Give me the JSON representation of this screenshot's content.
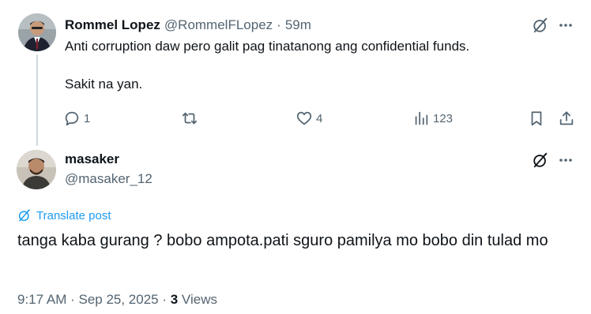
{
  "parent_tweet": {
    "author_name": "Rommel Lopez",
    "author_handle": "@RommelFLopez",
    "separator": "·",
    "time": "59m",
    "text_line_1": "Anti corruption daw pero galit pag tinatanong ang confidential funds.",
    "text_line_2": "Sakit na yan.",
    "actions": {
      "replies": "1",
      "retweets": "",
      "likes": "4",
      "views": "123"
    }
  },
  "main_tweet": {
    "author_name": "masaker",
    "author_handle": "@masaker_12",
    "translate_label": "Translate post",
    "text": "tanga kaba gurang ? bobo ampota.pati sguro pamilya mo bobo din tulad mo",
    "timestamp": "9:17 AM · Sep 25, 2025 · ",
    "views_count": "3",
    "views_label": " Views"
  },
  "colors": {
    "text_primary": "#0f1419",
    "text_secondary": "#536471",
    "accent_blue": "#1d9bf0",
    "thread_line": "#cfd9de"
  },
  "icons": {
    "grok": "grok-icon",
    "more": "more-icon",
    "reply": "reply-icon",
    "retweet": "retweet-icon",
    "like": "heart-icon",
    "views": "views-icon",
    "bookmark": "bookmark-icon",
    "share": "share-icon",
    "translate": "translate-icon"
  }
}
